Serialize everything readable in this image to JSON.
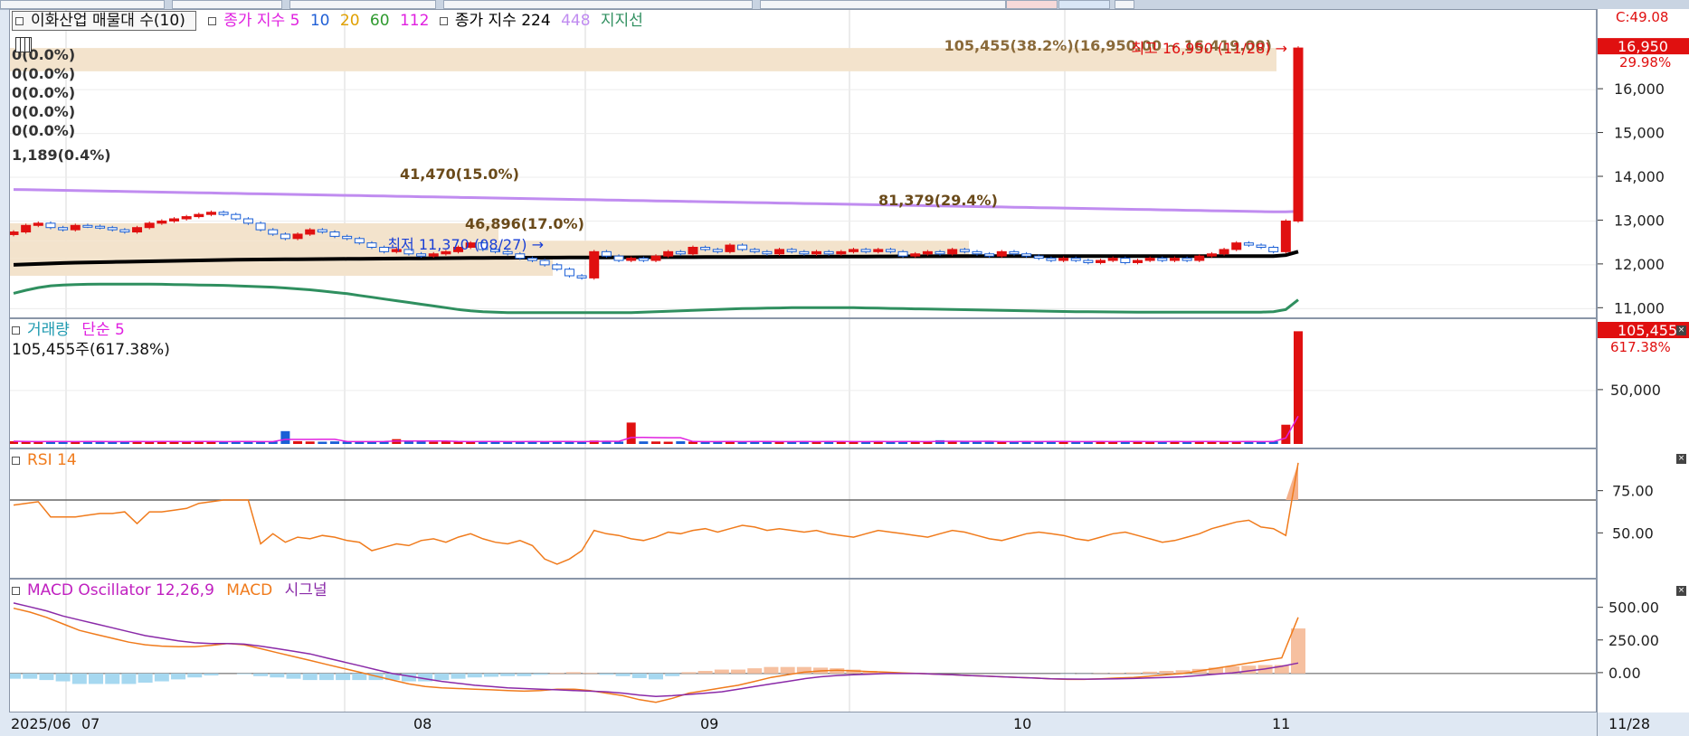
{
  "price_legend": {
    "title": "이화산업 매물대 수(10)",
    "ma_label": "종가 지수 5",
    "ma_periods": [
      {
        "label": "10",
        "color": "#1f5fd6"
      },
      {
        "label": "20",
        "color": "#e0a000"
      },
      {
        "label": "60",
        "color": "#2e9a2e"
      },
      {
        "label": "112",
        "color": "#e020e0"
      }
    ],
    "long_label": "종가 지수 224",
    "long_label_448": "448",
    "support_label": "지지선"
  },
  "price_annotations": {
    "high": "최고 16,950 (11/28) →",
    "low": "최저 11,370 (08/27) →",
    "top_band": "105,455(38.2%)(16,950.00 ~ 16,419.00)",
    "zero_bands": [
      "0(0.0%)",
      "0(0.0%)",
      "0(0.0%)",
      "0(0.0%)",
      "0(0.0%)"
    ],
    "band_1189": "1,189(0.4%)",
    "band_41470": "41,470(15.0%)",
    "band_81379": "81,379(29.4%)",
    "band_46896": "46,896(17.0%)"
  },
  "price_axis": {
    "ticks": [
      "16,000",
      "15,000",
      "14,000",
      "13,000",
      "12,000",
      "11,000"
    ],
    "current_label": "16,950",
    "change_label": "29.98%",
    "top_label": "C:49.08"
  },
  "volume_legend": {
    "label": "거래량",
    "ma_label": "단순 5",
    "info": "105,455주(617.38%)"
  },
  "volume_axis": {
    "ticks": [
      "50,000"
    ],
    "current_label": "105,455",
    "pct_label": "617.38%"
  },
  "rsi_legend": {
    "label": "RSI 14"
  },
  "rsi_axis": {
    "ticks": [
      "75.00",
      "50.00"
    ]
  },
  "macd_legend": {
    "label": "MACD Oscillator 12,26,9",
    "macd_label": "MACD",
    "signal_label": "시그널"
  },
  "macd_axis": {
    "ticks": [
      "500.00",
      "250.00",
      "0.00"
    ]
  },
  "date_axis": {
    "labels": [
      "2025/06",
      "07",
      "08",
      "09",
      "10",
      "11"
    ],
    "end_label": "11/28"
  },
  "colors": {
    "up": "#e01010",
    "down": "#1a5fd6",
    "rsi": "#f07b1c",
    "macd": "#f07b1c",
    "signal": "#8a2aa8",
    "support": "#2f8f5f",
    "ma224": "#000000",
    "ma448": "#c08cf0",
    "band": "#f3e3cc"
  },
  "chart_data": [
    {
      "type": "candlestick",
      "title": "이화산업 매물대 수(10)",
      "x_range": [
        "2025/06",
        "11/28"
      ],
      "ylim": [
        10800,
        17200
      ],
      "high": {
        "value": 16950,
        "date": "11/28"
      },
      "low": {
        "value": 11370,
        "date": "08/27"
      },
      "last_close": 16950,
      "change_pct": 29.98,
      "closes": [
        12750,
        12900,
        12950,
        12850,
        12800,
        12900,
        12880,
        12850,
        12800,
        12750,
        12850,
        12950,
        13000,
        13050,
        13100,
        13150,
        13200,
        13150,
        13050,
        12950,
        12800,
        12700,
        12600,
        12700,
        12800,
        12750,
        12650,
        12600,
        12500,
        12400,
        12300,
        12350,
        12250,
        12200,
        12250,
        12300,
        12400,
        12500,
        12350,
        12300,
        12250,
        12150,
        12100,
        12000,
        11900,
        11750,
        11700,
        12300,
        12200,
        12100,
        12150,
        12100,
        12200,
        12300,
        12250,
        12400,
        12350,
        12300,
        12450,
        12350,
        12300,
        12250,
        12350,
        12300,
        12250,
        12300,
        12250,
        12300,
        12350,
        12300,
        12350,
        12300,
        12200,
        12250,
        12300,
        12250,
        12350,
        12300,
        12250,
        12200,
        12300,
        12250,
        12200,
        12150,
        12100,
        12150,
        12100,
        12050,
        12100,
        12150,
        12050,
        12100,
        12150,
        12100,
        12150,
        12100,
        12200,
        12250,
        12350,
        12500,
        12450,
        12400,
        12300,
        13000,
        16950
      ],
      "ma224": [
        12000,
        12010,
        12020,
        12030,
        12040,
        12050,
        12055,
        12060,
        12065,
        12070,
        12075,
        12080,
        12085,
        12090,
        12095,
        12100,
        12105,
        12110,
        12115,
        12120,
        12122,
        12124,
        12126,
        12128,
        12130,
        12132,
        12134,
        12136,
        12138,
        12140,
        12142,
        12144,
        12146,
        12148,
        12150,
        12152,
        12154,
        12156,
        12158,
        12160,
        12161,
        12162,
        12163,
        12164,
        12165,
        12166,
        12167,
        12168,
        12169,
        12170,
        12171,
        12172,
        12173,
        12174,
        12175,
        12176,
        12177,
        12178,
        12179,
        12180,
        12181,
        12182,
        12183,
        12184,
        12185,
        12186,
        12187,
        12188,
        12189,
        12190,
        12191,
        12192,
        12193,
        12194,
        12195,
        12196,
        12197,
        12198,
        12199,
        12200,
        12200,
        12200,
        12200,
        12200,
        12200,
        12200,
        12200,
        12200,
        12200,
        12200,
        12200,
        12200,
        12200,
        12200,
        12200,
        12200,
        12200,
        12200,
        12200,
        12200,
        12200,
        12200,
        12200,
        12220,
        12300
      ],
      "ma448": [
        13720,
        13715,
        13710,
        13705,
        13700,
        13695,
        13690,
        13685,
        13680,
        13675,
        13670,
        13665,
        13660,
        13655,
        13650,
        13645,
        13640,
        13635,
        13630,
        13625,
        13620,
        13615,
        13610,
        13605,
        13600,
        13595,
        13590,
        13585,
        13580,
        13575,
        13570,
        13565,
        13560,
        13555,
        13550,
        13545,
        13540,
        13535,
        13530,
        13525,
        13520,
        13515,
        13510,
        13505,
        13500,
        13495,
        13490,
        13485,
        13480,
        13475,
        13470,
        13465,
        13460,
        13455,
        13450,
        13445,
        13440,
        13435,
        13430,
        13425,
        13420,
        13415,
        13410,
        13405,
        13400,
        13395,
        13390,
        13385,
        13380,
        13375,
        13370,
        13365,
        13360,
        13355,
        13350,
        13345,
        13340,
        13335,
        13330,
        13325,
        13320,
        13315,
        13310,
        13305,
        13300,
        13295,
        13290,
        13285,
        13280,
        13275,
        13270,
        13265,
        13260,
        13255,
        13250,
        13245,
        13240,
        13235,
        13230,
        13225,
        13220,
        13215,
        13210,
        13210,
        13220
      ],
      "support": [
        11350,
        11420,
        11480,
        11520,
        11540,
        11550,
        11555,
        11560,
        11560,
        11560,
        11560,
        11560,
        11555,
        11550,
        11545,
        11540,
        11535,
        11530,
        11520,
        11510,
        11500,
        11490,
        11470,
        11450,
        11430,
        11400,
        11370,
        11340,
        11300,
        11260,
        11220,
        11180,
        11140,
        11100,
        11060,
        11020,
        10980,
        10950,
        10930,
        10920,
        10910,
        10910,
        10910,
        10910,
        10910,
        10910,
        10910,
        10910,
        10910,
        10910,
        10910,
        10920,
        10930,
        10940,
        10950,
        10960,
        10970,
        10980,
        10990,
        11000,
        11005,
        11010,
        11015,
        11020,
        11020,
        11020,
        11020,
        11020,
        11020,
        11015,
        11010,
        11005,
        11000,
        10995,
        10990,
        10985,
        10980,
        10975,
        10970,
        10965,
        10960,
        10955,
        10950,
        10945,
        10940,
        10935,
        10930,
        10928,
        10926,
        10924,
        10922,
        10920,
        10920,
        10920,
        10920,
        10920,
        10920,
        10920,
        10920,
        10920,
        10920,
        10920,
        10930,
        10980,
        11200
      ]
    },
    {
      "type": "bar",
      "title": "거래량",
      "last_value": 105455,
      "last_pct": 617.38,
      "ytick": 50000,
      "ylim": [
        0,
        110000
      ],
      "values": [
        2500,
        2200,
        2000,
        2600,
        2300,
        2100,
        2400,
        2200,
        2000,
        2500,
        2300,
        2100,
        2600,
        2200,
        2000,
        2400,
        2300,
        2100,
        2500,
        2200,
        2000,
        2400,
        12000,
        2600,
        2300,
        2100,
        2400,
        2200,
        2000,
        2500,
        2300,
        4500,
        2600,
        2200,
        2000,
        2400,
        2300,
        2100,
        2500,
        2200,
        2000,
        2400,
        2300,
        2100,
        2500,
        2200,
        2000,
        3200,
        2600,
        2200,
        20000,
        2400,
        2300,
        2100,
        2500,
        2200,
        2000,
        2400,
        2300,
        2100,
        2500,
        2200,
        2000,
        2400,
        2300,
        2100,
        2500,
        2200,
        2000,
        2400,
        2300,
        2100,
        2500,
        2200,
        2000,
        3500,
        2300,
        2100,
        2500,
        2200,
        2000,
        2400,
        2300,
        2100,
        2500,
        2200,
        2000,
        2400,
        2300,
        2100,
        2500,
        2200,
        2000,
        2400,
        2300,
        2100,
        2500,
        2200,
        2000,
        2400,
        2300,
        2100,
        2500,
        18000,
        105455
      ]
    },
    {
      "type": "line",
      "title": "RSI 14",
      "yticks": [
        75,
        50
      ],
      "ylim": [
        25,
        100
      ],
      "values": [
        67,
        68,
        69,
        60,
        60,
        60,
        61,
        62,
        62,
        63,
        56,
        63,
        63,
        64,
        65,
        68,
        69,
        70,
        70,
        70,
        44,
        50,
        45,
        48,
        47,
        49,
        48,
        46,
        45,
        40,
        42,
        44,
        43,
        46,
        47,
        45,
        48,
        50,
        47,
        45,
        44,
        46,
        43,
        35,
        32,
        35,
        40,
        52,
        50,
        49,
        47,
        46,
        48,
        51,
        50,
        52,
        53,
        51,
        53,
        55,
        54,
        52,
        53,
        52,
        51,
        52,
        50,
        49,
        48,
        50,
        52,
        51,
        50,
        49,
        48,
        50,
        52,
        51,
        49,
        47,
        46,
        48,
        50,
        51,
        50,
        49,
        47,
        46,
        48,
        50,
        51,
        49,
        47,
        45,
        46,
        48,
        50,
        53,
        55,
        57,
        58,
        54,
        53,
        49,
        92
      ]
    },
    {
      "type": "line",
      "title": "MACD Oscillator 12,26,9",
      "yticks": [
        500,
        250,
        0
      ],
      "ylim": [
        -250,
        650
      ],
      "macd": [
        500,
        470,
        430,
        380,
        330,
        300,
        270,
        240,
        220,
        210,
        205,
        205,
        215,
        230,
        220,
        190,
        160,
        130,
        100,
        70,
        40,
        10,
        -20,
        -50,
        -80,
        -100,
        -110,
        -115,
        -120,
        -125,
        -130,
        -135,
        -130,
        -120,
        -120,
        -130,
        -150,
        -170,
        -200,
        -220,
        -190,
        -150,
        -130,
        -110,
        -90,
        -60,
        -30,
        -10,
        10,
        20,
        25,
        20,
        15,
        10,
        5,
        0,
        -5,
        -10,
        -15,
        -20,
        -25,
        -30,
        -35,
        -40,
        -45,
        -45,
        -40,
        -35,
        -30,
        -20,
        -10,
        0,
        20,
        40,
        60,
        80,
        100,
        120,
        430
      ],
      "signal": [
        540,
        510,
        480,
        440,
        410,
        380,
        350,
        320,
        290,
        270,
        250,
        235,
        230,
        230,
        225,
        210,
        190,
        170,
        150,
        120,
        90,
        60,
        30,
        0,
        -20,
        -40,
        -60,
        -75,
        -90,
        -100,
        -110,
        -115,
        -120,
        -125,
        -130,
        -135,
        -140,
        -150,
        -165,
        -175,
        -170,
        -160,
        -150,
        -140,
        -120,
        -100,
        -80,
        -60,
        -40,
        -25,
        -15,
        -10,
        -5,
        0,
        0,
        0,
        -5,
        -10,
        -15,
        -20,
        -25,
        -30,
        -35,
        -40,
        -42,
        -43,
        -42,
        -40,
        -38,
        -34,
        -30,
        -25,
        -15,
        -5,
        5,
        20,
        35,
        55,
        80
      ],
      "oscillator_last": 345
    }
  ]
}
